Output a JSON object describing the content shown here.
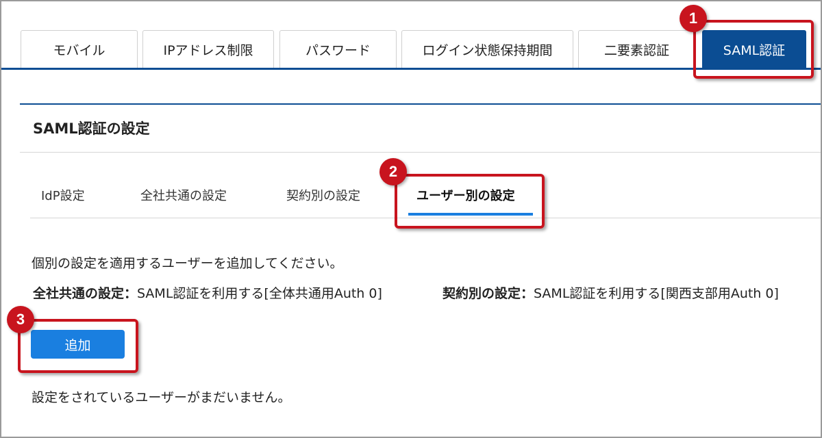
{
  "top_tabs": [
    {
      "label": "モバイル",
      "active": false
    },
    {
      "label": "IPアドレス制限",
      "active": false
    },
    {
      "label": "パスワード",
      "active": false
    },
    {
      "label": "ログイン状態保持期間",
      "active": false
    },
    {
      "label": "二要素認証",
      "active": false
    },
    {
      "label": "SAML認証",
      "active": true
    }
  ],
  "section": {
    "title": "SAML認証の設定"
  },
  "sub_tabs": [
    {
      "label": "IdP設定",
      "active": false
    },
    {
      "label": "全社共通の設定",
      "active": false
    },
    {
      "label": "契約別の設定",
      "active": false
    },
    {
      "label": "ユーザー別の設定",
      "active": true
    }
  ],
  "content": {
    "instruction": "個別の設定を適用するユーザーを追加してください。",
    "company_setting_label": "全社共通の設定：",
    "company_setting_value": "SAML認証を利用する[全体共通用Auth 0]",
    "contract_setting_label": "契約別の設定：",
    "contract_setting_value": "SAML認証を利用する[関西支部用Auth 0]",
    "add_button_label": "追加",
    "empty_message": "設定をされているユーザーがまだいません。"
  },
  "annotations": {
    "badge_1": "1",
    "badge_2": "2",
    "badge_3": "3",
    "color": "#c8141e"
  },
  "colors": {
    "primary_dark": "#0b4d93",
    "accent_blue": "#1a7fe0"
  }
}
